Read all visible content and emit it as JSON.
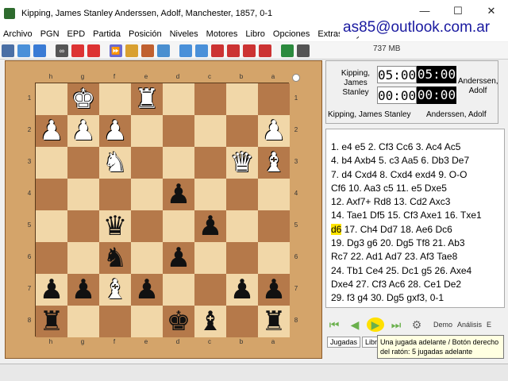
{
  "window": {
    "title": "Kipping, James Stanley    Anderssen, Adolf,  Manchester,  1857,  0-1",
    "minimize": "—",
    "maximize": "☐",
    "close": "✕"
  },
  "menu": [
    "Archivo",
    "PGN",
    "EPD",
    "Partida",
    "Posición",
    "Niveles",
    "Motores",
    "Libro",
    "Opciones",
    "Extras",
    "Ayuda"
  ],
  "watermark": "as85@outlook.com.ar",
  "toolbar": {
    "memory": "737 MB",
    "buttons": [
      {
        "icon": "board-icon",
        "color": "#4a6fa5",
        "label": ""
      },
      {
        "icon": "open-icon",
        "color": "#4a90d9",
        "label": ""
      },
      {
        "icon": "save-icon",
        "color": "#3a7bd5",
        "label": ""
      },
      {
        "icon": "infinity-icon",
        "color": "#555",
        "label": "∞"
      },
      {
        "icon": "level-icon",
        "color": "#d33",
        "label": ""
      },
      {
        "icon": "level-icon-2",
        "color": "#d33",
        "label": ""
      },
      {
        "icon": "demo-icon",
        "color": "#6a6ad0",
        "label": "⏩"
      },
      {
        "icon": "flip-icon",
        "color": "#d9a030",
        "label": ""
      },
      {
        "icon": "calendar-icon",
        "color": "#c06030",
        "label": ""
      },
      {
        "icon": "pgn-icon",
        "color": "#4a8fd0",
        "label": ""
      },
      {
        "icon": "zoom-in-icon",
        "color": "#4a90d9",
        "label": ""
      },
      {
        "icon": "zoom-out-icon",
        "color": "#4a90d9",
        "label": ""
      },
      {
        "icon": "pgn-plus-icon",
        "color": "#c33",
        "label": ""
      },
      {
        "icon": "pgn-minus-icon",
        "color": "#c33",
        "label": ""
      },
      {
        "icon": "epd-plus-icon",
        "color": "#c33",
        "label": ""
      },
      {
        "icon": "epd-minus-icon",
        "color": "#c33",
        "label": ""
      },
      {
        "icon": "globe-icon",
        "color": "#2b8a3e",
        "label": ""
      },
      {
        "icon": "engine-icon",
        "color": "#555",
        "label": ""
      }
    ]
  },
  "board": {
    "files": [
      "h",
      "g",
      "f",
      "e",
      "d",
      "c",
      "b",
      "a"
    ],
    "ranks": [
      "1",
      "2",
      "3",
      "4",
      "5",
      "6",
      "7",
      "8"
    ],
    "squares": [
      [
        "",
        "K",
        "",
        "R",
        "",
        "",
        "",
        ""
      ],
      [
        "P",
        "P",
        "P",
        "",
        "",
        "",
        "",
        "P"
      ],
      [
        "",
        "",
        "N",
        "",
        "",
        "",
        "Q",
        "B"
      ],
      [
        "",
        "",
        "",
        "",
        "p",
        "",
        "",
        ""
      ],
      [
        "",
        "",
        "q",
        "",
        "",
        "p",
        "",
        ""
      ],
      [
        "",
        "",
        "n",
        "",
        "p",
        "",
        "",
        ""
      ],
      [
        "p",
        "p",
        "B",
        "p",
        "",
        "",
        "p",
        "p"
      ],
      [
        "r",
        "",
        "",
        "",
        "k",
        "b",
        "",
        "r"
      ]
    ],
    "glyphs": {
      "K": "♚",
      "Q": "♛",
      "R": "♜",
      "B": "♝",
      "N": "♞",
      "P": "♟",
      "k": "♚",
      "q": "♛",
      "r": "♜",
      "b": "♝",
      "n": "♞",
      "p": "♟"
    }
  },
  "clocks": {
    "white_name": "Kipping, James Stanley",
    "black_name": "Anderssen, Adolf",
    "white_time_top": "05:00",
    "black_time_top": "05:00",
    "white_time_bottom": "00:00",
    "black_time_bottom": "00:00",
    "white_label": "Kipping, James Stanley",
    "black_label": "Anderssen, Adolf"
  },
  "moves": [
    [
      {
        "t": "1. e4 e5 2. Cf3 Cc6 3. Ac4 Ac5"
      }
    ],
    [
      {
        "t": "4. b4 Axb4 5. c3 Aa5 6. Db3 De7"
      }
    ],
    [
      {
        "t": "7. d4 Cxd4 8. Cxd4 exd4 9. O-O"
      }
    ],
    [
      {
        "t": "Cf6 10. Aa3 c5 11. e5 Dxe5"
      }
    ],
    [
      {
        "t": "12. Axf7+ Rd8 13. Cd2 Axc3"
      }
    ],
    [
      {
        "t": "14. Tae1 Df5 15. Cf3 Axe1 16. Txe1"
      }
    ],
    [
      {
        "t": "d6",
        "hl": true
      },
      {
        "t": " 17. Ch4 Dd7 18. Ae6 Dc6"
      }
    ],
    [
      {
        "t": "19. Dg3 g6 20. Dg5 Tf8 21. Ab3"
      }
    ],
    [
      {
        "t": "Rc7 22. Ad1 Ad7 23. Af3 Tae8"
      }
    ],
    [
      {
        "t": "24. Tb1 Ce4 25. Dc1 g5 26. Axe4"
      }
    ],
    [
      {
        "t": "Dxe4 27. Cf3 Ac6 28. Ce1 De2"
      }
    ],
    [
      {
        "t": "29. f3 g4 30. Dg5 gxf3, 0-1"
      }
    ]
  ],
  "nav": {
    "demo": "Demo",
    "analysis": "Análisis",
    "more": "E",
    "tab1": "Jugadas",
    "tab2": "Libr"
  },
  "tooltip": "Una jugada adelante / Botón derecho del ratón: 5 jugadas adelante",
  "status": ""
}
